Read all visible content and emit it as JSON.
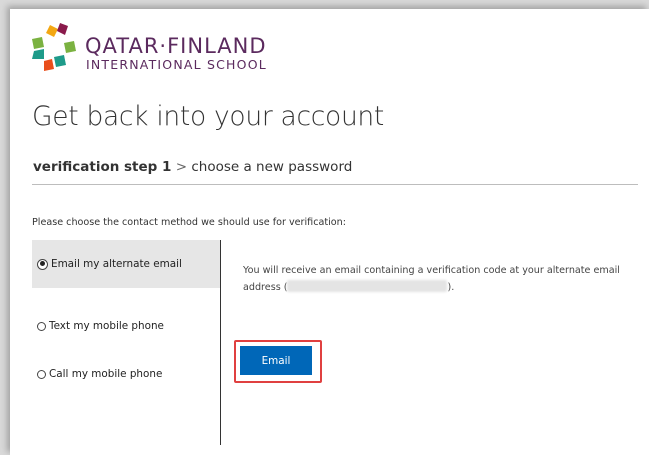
{
  "logo": {
    "line1": "QATAR·FINLAND",
    "line2": "INTERNATIONAL SCHOOL",
    "colors": [
      "#e94e1b",
      "#f3a712",
      "#8a1a4b",
      "#1e9b8a",
      "#7bb241",
      "#5b2a5e"
    ]
  },
  "page": {
    "title": "Get back into your account"
  },
  "breadcrumb": {
    "current": "verification step 1",
    "separator": ">",
    "next": "choose a new password"
  },
  "instructions": "Please choose the contact method we should use for verification:",
  "options": [
    {
      "label": "Email my alternate email",
      "selected": true
    },
    {
      "label": "Text my mobile phone",
      "selected": false
    },
    {
      "label": "Call my mobile phone",
      "selected": false
    }
  ],
  "description": {
    "line1": "You will receive an email containing a verification code at your alternate email",
    "address_prefix": "address (",
    "address_suffix": ")."
  },
  "email_button": {
    "label": "Email",
    "color": "#0067b8"
  },
  "highlight_color": "#e04040"
}
